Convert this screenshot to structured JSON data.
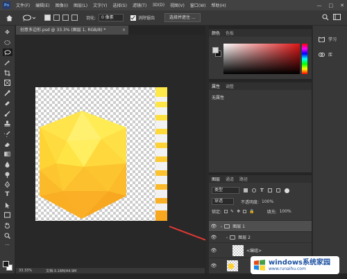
{
  "menubar": {
    "logo": "Ps",
    "items": [
      "文件(F)",
      "编辑(E)",
      "图像(I)",
      "图层(L)",
      "文字(Y)",
      "选择(S)",
      "滤镜(T)",
      "3D(D)",
      "视图(V)",
      "窗口(W)",
      "帮助(H)"
    ],
    "window_controls": [
      "—",
      "□",
      "✕"
    ]
  },
  "options": {
    "feather_label": "羽化:",
    "feather_value": "0 像素",
    "antialias_label": "消除锯齿",
    "select_mask_button": "选择并遮住 ..."
  },
  "document": {
    "tab_title": "创意多边形.psd @ 33.3% (图层 1, RGB/8) *",
    "close": "×"
  },
  "status": {
    "zoom": "33.33%",
    "doc_info": "文档:3.16M/44.9M"
  },
  "color_panel": {
    "tabs": [
      "颜色",
      "色板"
    ]
  },
  "properties_panel": {
    "tabs": [
      "属性",
      "调整"
    ],
    "empty_text": "无属性"
  },
  "layers_panel": {
    "tabs": [
      "图层",
      "通道",
      "路径"
    ],
    "filter_kind": "类型",
    "blend_mode": "穿透",
    "opacity_label": "不透明度:",
    "opacity_value": "100%",
    "lock_label": "锁定:",
    "fill_label": "填充:",
    "fill_value": "100%",
    "layers": [
      {
        "name": "图层 1",
        "type": "group"
      },
      {
        "name": "图层 2",
        "type": "group"
      },
      {
        "name": "<编组>",
        "type": "layer"
      },
      {
        "name": "",
        "type": "layer"
      }
    ]
  },
  "side_dock": {
    "items": [
      "学习",
      "库"
    ]
  },
  "watermark": {
    "brand": "windows系统家园",
    "url": "www.runaihu.com"
  },
  "colors": {
    "accent_arrow": "#e53935",
    "hexagon_light": "#ffe24a",
    "hexagon_dark": "#f8a920",
    "panel_bg": "#383838"
  }
}
